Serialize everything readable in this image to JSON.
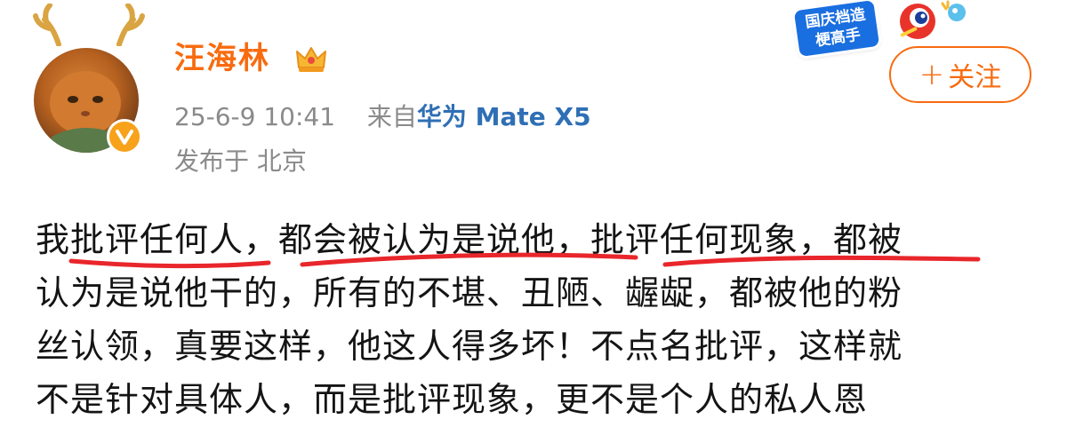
{
  "post": {
    "author": {
      "name": "汪海林",
      "crown_icon": "crown-icon",
      "verified_icon": "verified-v-icon",
      "avatar_desc": "orange cat with antler headband"
    },
    "meta": {
      "datetime": "25-6-9 10:41",
      "source_prefix": "来自",
      "device": "华为 Mate X5",
      "location": "发布于 北京"
    },
    "sticker": {
      "text": "国庆档造梗高手"
    },
    "follow_button": {
      "label": "关注",
      "icon": "plus-icon"
    },
    "body": {
      "lines": [
        "我批评任何人，都会被认为是说他，批评任何现象，都被",
        "认为是说他干的，所有的不堪、丑陋、龌龊，都被他的粉",
        "丝认领，真要这样，他这人得多坏！不点名批评，这样就",
        "不是针对具体人，而是批评现象，更不是个人的私人恩"
      ]
    },
    "colors": {
      "name": "#f86b0f",
      "device": "#2f6fb5",
      "meta": "#8a8a8a",
      "underline": "#e8262b",
      "text": "#141414"
    }
  }
}
